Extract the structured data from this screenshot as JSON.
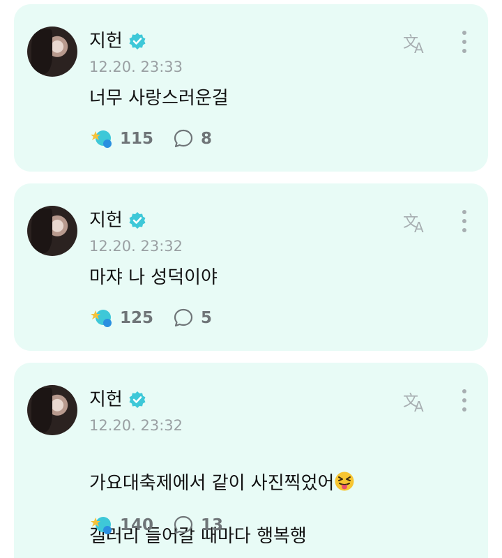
{
  "posts": [
    {
      "author": "지헌",
      "timestamp": "12.20. 23:33",
      "message": "너무 사랑스러운걸",
      "reaction_count": "115",
      "comment_count": "8"
    },
    {
      "author": "지헌",
      "timestamp": "12.20. 23:32",
      "message": "마쟈 나 성덕이야",
      "reaction_count": "125",
      "comment_count": "5"
    },
    {
      "author": "지헌",
      "timestamp": "12.20. 23:32",
      "message_line1": "가요대축제에서 같이 사진찍었어",
      "message_line2": "갤러리 들어갈 때마다 행복행",
      "emoji": "squinting-face-with-tongue",
      "reaction_count": "140",
      "comment_count": "13"
    }
  ],
  "colors": {
    "card_bg": "#e8fbf6",
    "verified": "#3ec8d8",
    "muted_text": "#9aa0a3"
  }
}
